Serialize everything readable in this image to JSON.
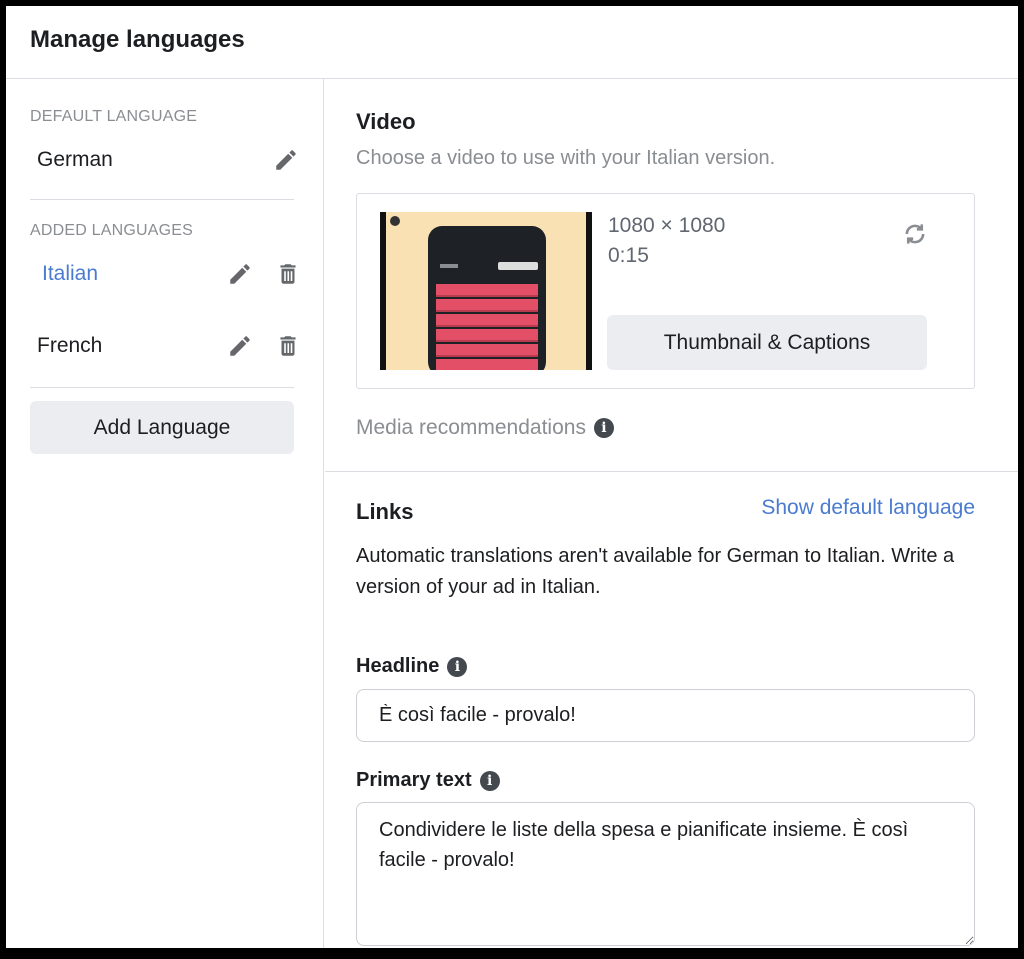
{
  "header": {
    "title": "Manage languages"
  },
  "sidebar": {
    "default_label": "DEFAULT LANGUAGE",
    "default_language": "German",
    "added_label": "ADDED LANGUAGES",
    "languages": [
      {
        "name": "Italian",
        "active": true
      },
      {
        "name": "French",
        "active": false
      }
    ],
    "add_button": "Add Language"
  },
  "video": {
    "title": "Video",
    "subtitle": "Choose a video to use with your Italian version.",
    "dimensions": "1080 × 1080",
    "duration": "0:15",
    "thumbnail_button": "Thumbnail & Captions",
    "media_recommendations": "Media recommendations"
  },
  "links": {
    "title": "Links",
    "show_default": "Show default language",
    "notice": "Automatic translations aren't available for German to Italian. Write a version of your ad in Italian.",
    "headline_label": "Headline",
    "headline_value": "È così facile - provalo!",
    "primary_label": "Primary text",
    "primary_value": "Condividere le liste della spesa e pianificate insieme. È così facile - provalo!"
  },
  "icons": {
    "edit": "pencil-icon",
    "delete": "trash-icon",
    "refresh": "refresh-icon",
    "info": "info-icon"
  },
  "colors": {
    "link": "#4a7bd0",
    "muted": "#8a8d91",
    "button_bg": "#ebedf0",
    "thumb_bg": "#f9e1b3",
    "thumb_accent": "#e24f66"
  }
}
